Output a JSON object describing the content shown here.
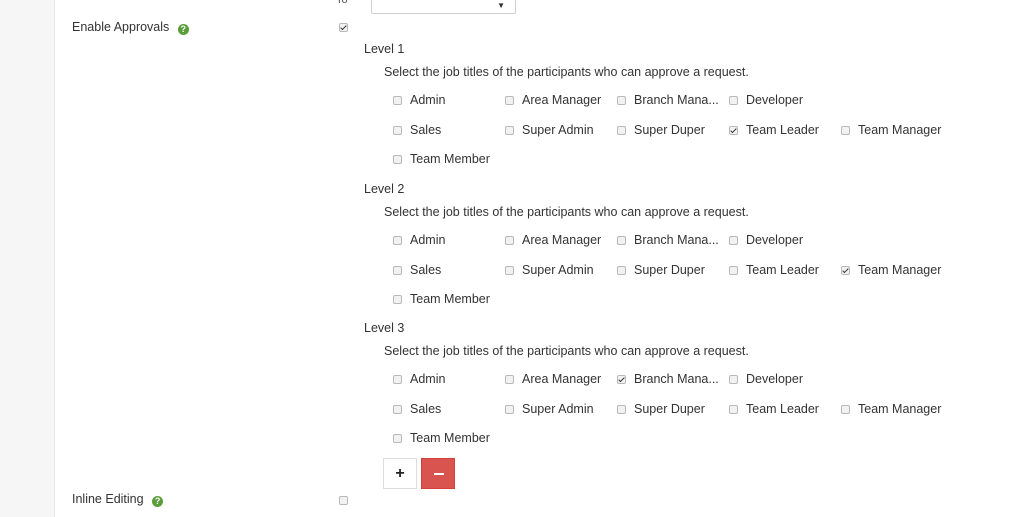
{
  "top_row": {
    "to_label": "To",
    "select_value": ""
  },
  "enable_approvals": {
    "label": "Enable Approvals",
    "help_icon": "question-circle-icon",
    "checked": true
  },
  "inline_editing": {
    "label": "Inline Editing",
    "help_icon": "question-circle-icon",
    "checked": false
  },
  "instruction_text": "Select the job titles of the participants who can approve a request.",
  "job_titles": [
    "Admin",
    "Area Manager",
    "Branch Mana...",
    "Developer",
    "Sales",
    "Super Admin",
    "Super Duper",
    "Team Leader",
    "Team Manager",
    "Team Member"
  ],
  "levels": [
    {
      "title": "Level 1",
      "checked": [
        false,
        false,
        false,
        false,
        false,
        false,
        false,
        true,
        false,
        false
      ]
    },
    {
      "title": "Level 2",
      "checked": [
        false,
        false,
        false,
        false,
        false,
        false,
        false,
        false,
        true,
        false
      ]
    },
    {
      "title": "Level 3",
      "checked": [
        false,
        false,
        true,
        false,
        false,
        false,
        false,
        false,
        false,
        false
      ]
    }
  ],
  "buttons": {
    "add_label": "+",
    "add_icon": "plus-icon",
    "remove_icon": "minus-icon"
  },
  "colors": {
    "help_icon": "#5a9e3a",
    "remove_button": "#d9534f"
  }
}
